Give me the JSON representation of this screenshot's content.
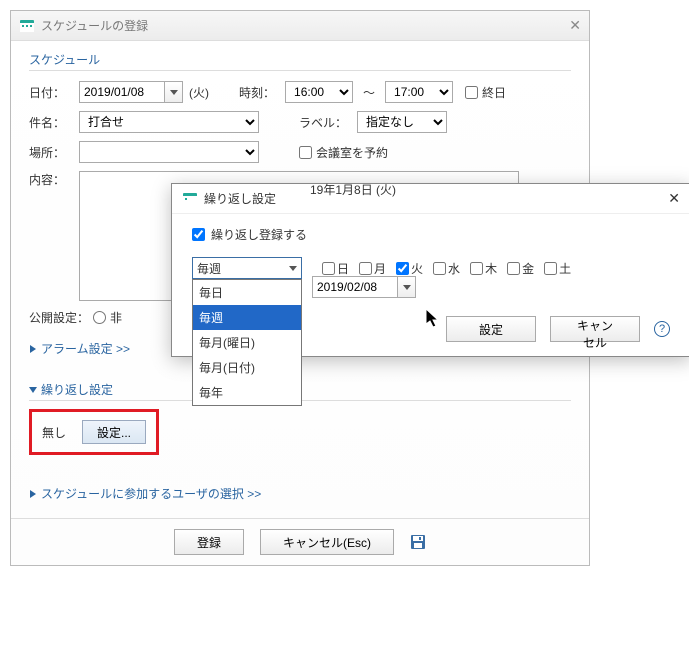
{
  "window": {
    "title": "スケジュールの登録"
  },
  "schedule": {
    "section_title": "スケジュール",
    "date_label": "日付：",
    "date_value": "2019/01/08",
    "day_of_week": "(火)",
    "time_label": "時刻：",
    "time_start": "16:00",
    "range_sep": "～",
    "time_end": "17:00",
    "allday_label": "終日",
    "subject_label": "件名：",
    "subject_value": "打合せ",
    "labelfield_label": "ラベル：",
    "labelfield_value": "指定なし",
    "location_label": "場所：",
    "location_value": "",
    "reserve_room_label": "会議室を予約",
    "content_label": "内容：",
    "visibility_label": "公開設定：",
    "visibility_option_partial": "非"
  },
  "alarm_link": "アラーム設定 >>",
  "repeat_section_title": "繰り返し設定",
  "repeat_box": {
    "none": "無し",
    "settings_btn": "設定..."
  },
  "participants_link": "スケジュールに参加するユーザの選択 >>",
  "footer": {
    "register": "登録",
    "cancel": "キャンセル(Esc)"
  },
  "modal": {
    "title": "繰り返し設定",
    "enable_label": "繰り返し登録する",
    "freq_selected": "毎週",
    "freq_options": [
      "毎日",
      "毎週",
      "毎月(曜日)",
      "毎月(日付)",
      "毎年"
    ],
    "days": {
      "sun": "日",
      "mon": "月",
      "tue": "火",
      "wed": "水",
      "thu": "木",
      "fri": "金",
      "sat": "土"
    },
    "checked_day": "tue",
    "start_text": "19年1月8日 (火)",
    "until_value": "2019/02/08",
    "ok": "設定",
    "cancel": "キャンセル"
  }
}
